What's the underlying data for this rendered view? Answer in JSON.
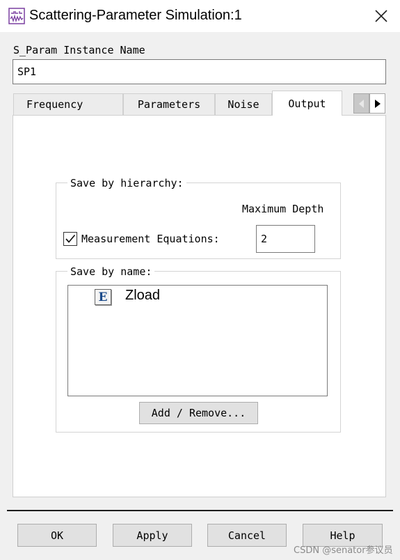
{
  "window": {
    "title": "Scattering-Parameter Simulation:1"
  },
  "instance": {
    "label": "S_Param Instance Name",
    "value": "SP1"
  },
  "tabs": [
    {
      "label": "Frequency",
      "selected": false
    },
    {
      "label": "Parameters",
      "selected": false
    },
    {
      "label": "Noise",
      "selected": false
    },
    {
      "label": "Output",
      "selected": true
    }
  ],
  "save_by_hierarchy": {
    "legend": "Save by hierarchy:",
    "max_depth_label": "Maximum Depth",
    "measurement_label": "Measurement Equations:",
    "measurement_checked": true,
    "depth_value": "2"
  },
  "save_by_name": {
    "legend": "Save by name:",
    "items": [
      {
        "icon_letter": "E",
        "icon": "equation-icon",
        "label": "Zload"
      }
    ],
    "add_remove_label": "Add / Remove..."
  },
  "buttons": {
    "ok": "OK",
    "apply": "Apply",
    "cancel": "Cancel",
    "help": "Help"
  },
  "watermark": "CSDN @senator参议员",
  "colors": {
    "window_bg": "#f0f0f0",
    "panel_bg": "#ffffff",
    "button_bg": "#e1e1e1",
    "icon_accent": "#7a3fa0"
  }
}
